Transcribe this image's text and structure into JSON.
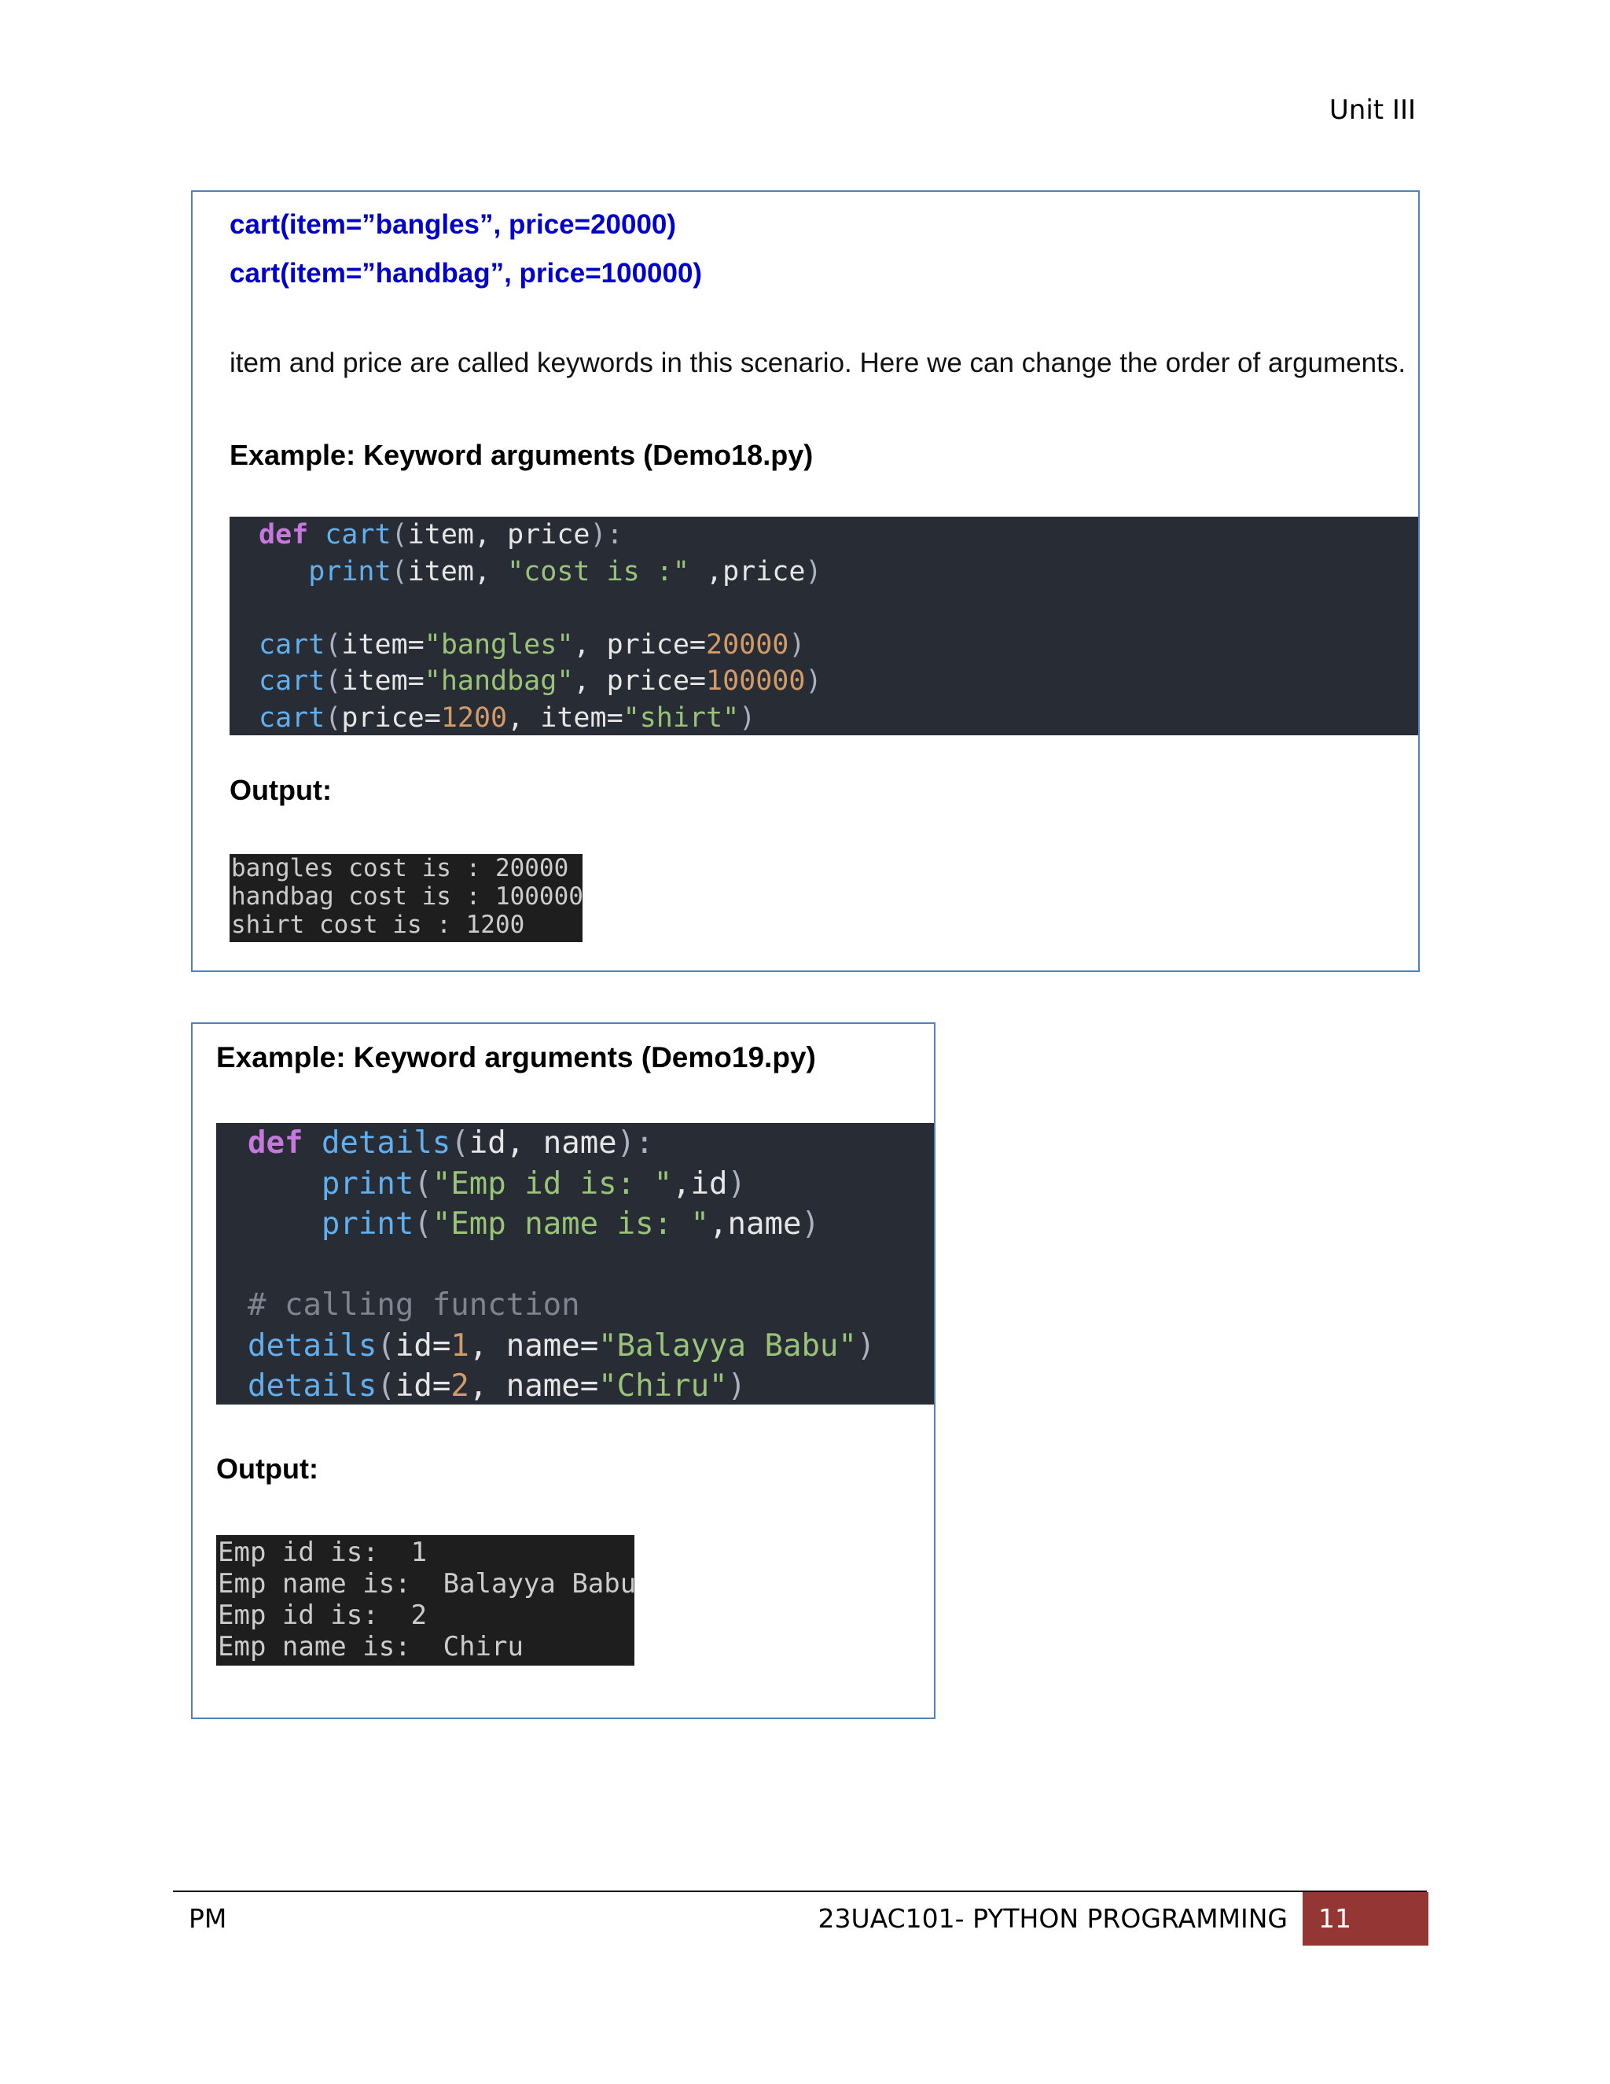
{
  "header": {
    "unit": "Unit III"
  },
  "section1": {
    "call_lines": [
      "cart(item=”bangles”, price=20000)",
      "cart(item=”handbag”, price=100000)"
    ],
    "paragraph": "item and price are called keywords in this scenario. Here we can change the order of arguments.",
    "example_heading": "Example: Keyword arguments (Demo18.py)",
    "output_heading": "Output:",
    "output_lines": [
      "bangles cost is : 20000",
      "handbag cost is : 100000",
      "shirt cost is : 1200"
    ]
  },
  "section2": {
    "example_heading": "Example: Keyword arguments (Demo19.py)",
    "output_heading": "Output:",
    "output_lines": [
      "Emp id is:  1",
      "Emp name is:  Balayya Babu",
      "Emp id is:  2",
      "Emp name is:  Chiru"
    ]
  },
  "code_tokens": {
    "def": "def",
    "cart": "cart",
    "details": "details",
    "print": "print",
    "item": "item",
    "price": "price",
    "id": "id",
    "name": "name",
    "s_cost": "\"cost is :\"",
    "s_bangles": "\"bangles\"",
    "s_handbag": "\"handbag\"",
    "s_shirt": "\"shirt\"",
    "n_20000": "20000",
    "n_100000": "100000",
    "n_1200": "1200",
    "s_empid": "\"Emp id is: \"",
    "s_empname": "\"Emp name is: \"",
    "comment": "# calling function",
    "s_balayya": "\"Balayya Babu\"",
    "s_chiru": "\"Chiru\"",
    "n_1": "1",
    "n_2": "2"
  },
  "footer": {
    "left": "PM",
    "title": "23UAC101- PYTHON PROGRAMMING",
    "page": "11"
  }
}
